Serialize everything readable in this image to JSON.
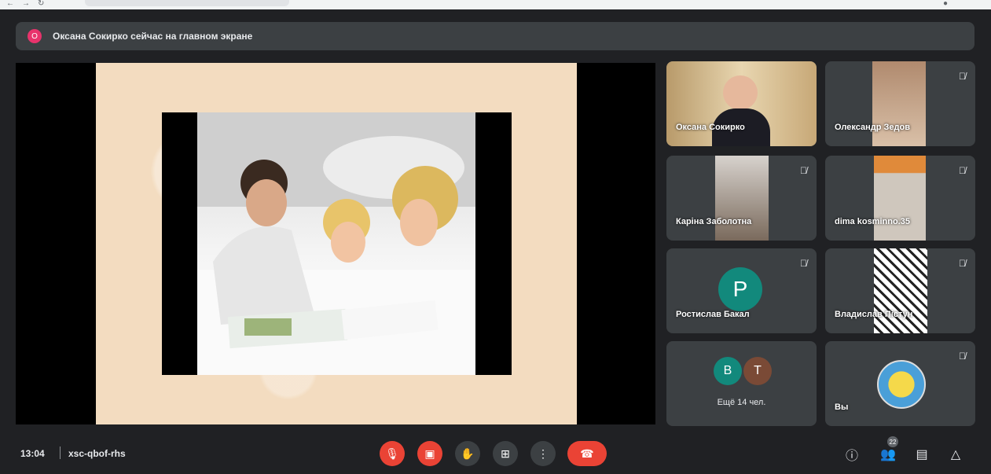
{
  "banner": {
    "avatar_letter": "O",
    "text": "Оксана Сокирко сейчас на главном экране"
  },
  "participants": [
    {
      "name": "Оксана Сокирко"
    },
    {
      "name": "Олександр Зедов"
    },
    {
      "name": "Каріна Заболотна"
    },
    {
      "name": "dima kosminno.35"
    },
    {
      "name": "Ростислав Бакал",
      "avatar_letter": "P"
    },
    {
      "name": "Владислав Пістун"
    }
  ],
  "more": {
    "avatars": [
      "B",
      "T"
    ],
    "label": "Ещё 14 чел."
  },
  "self": {
    "label": "Вы"
  },
  "meeting": {
    "time": "13:04",
    "code": "xsc-qbof-rhs"
  },
  "people_count": "22",
  "colors": {
    "accent_red": "#ea4335",
    "avatar_teal": "#12897c",
    "surface": "#3c4043",
    "background": "#202124"
  }
}
